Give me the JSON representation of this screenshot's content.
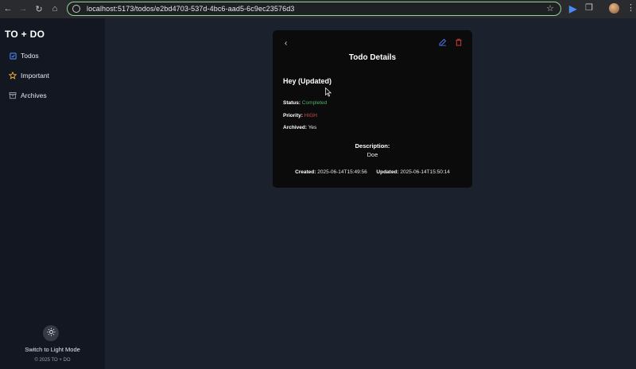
{
  "browser": {
    "url": "localhost:5173/todos/e2bd4703-537d-4bc6-aad5-6c9ec23576d3",
    "icons": [
      "back-arrow-icon",
      "forward-arrow-icon",
      "reload-icon",
      "home-icon",
      "site-info-icon",
      "bookmark-star-icon",
      "extension-d-icon",
      "extensions-puzzle-icon",
      "profile-avatar",
      "menu-kebab-icon"
    ]
  },
  "sidebar": {
    "brand": "TO + DO",
    "items": [
      {
        "label": "Todos",
        "icon": "checkbox-icon",
        "color": "#4a8af4"
      },
      {
        "label": "Important",
        "icon": "star-icon",
        "color": "#f0b429"
      },
      {
        "label": "Archives",
        "icon": "archive-icon",
        "color": "#9aa1ac"
      }
    ],
    "theme_toggle_label": "Switch to Light Mode",
    "copyright": "© 2025 TO + DO"
  },
  "card": {
    "title": "Todo Details",
    "todo_title": "Hey (Updated)",
    "status_label": "Status:",
    "status_value": "Completed",
    "priority_label": "Priority:",
    "priority_value": "HIGH",
    "archived_label": "Archived:",
    "archived_value": "Yes",
    "description_label": "Description:",
    "description_value": "Doe",
    "created_label": "Created:",
    "created_value": "2025-06-14T15:49:56",
    "updated_label": "Updated:",
    "updated_value": "2025-06-14T15:50:14"
  },
  "colors": {
    "accent": "#4a74e6",
    "success": "#4fb463",
    "danger": "#d14a43"
  }
}
